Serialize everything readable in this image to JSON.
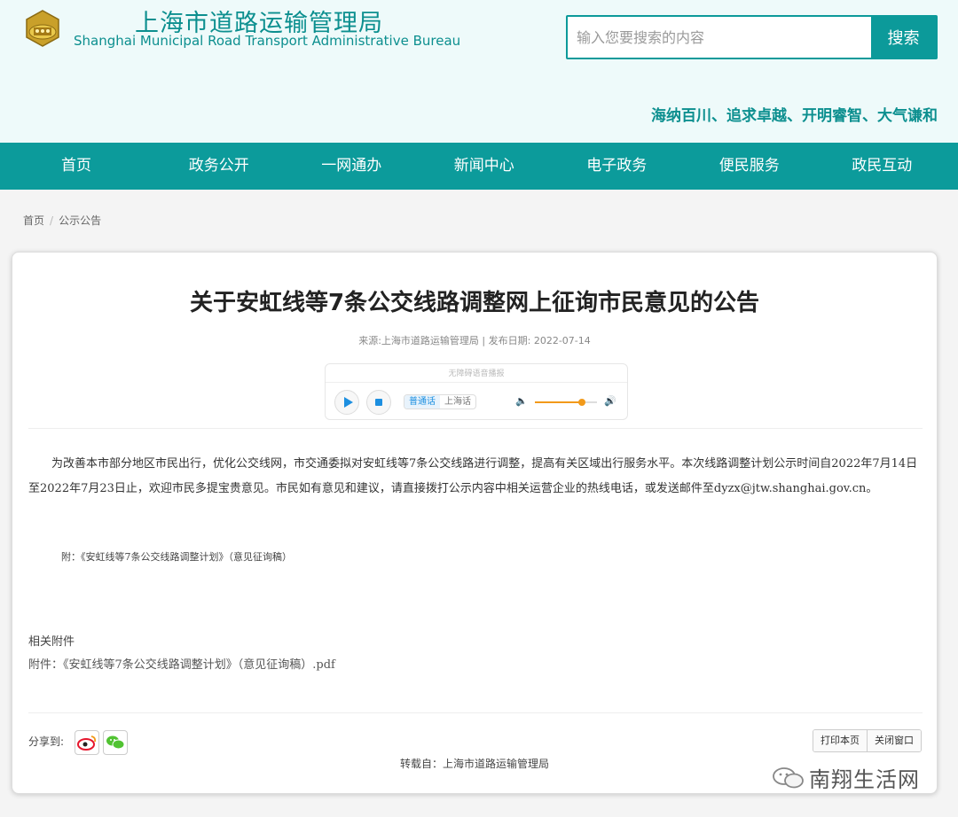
{
  "header": {
    "title_cn": "上海市道路运输管理局",
    "title_en": "Shanghai Municipal Road Transport Administrative Bureau",
    "search_placeholder": "输入您要搜索的内容",
    "search_button": "搜索",
    "slogan": "海纳百川、追求卓越、开明睿智、大气谦和",
    "brand_color": "#0c9b9b"
  },
  "nav": {
    "items": [
      "首页",
      "政务公开",
      "一网通办",
      "新闻中心",
      "电子政务",
      "便民服务",
      "政民互动"
    ]
  },
  "breadcrumb": {
    "home": "首页",
    "separator": "/",
    "current": "公示公告"
  },
  "article": {
    "title": "关于安虹线等7条公交线路调整网上征询市民意见的公告",
    "meta": "来源:上海市道路运输管理局 | 发布日期: 2022-07-14",
    "player": {
      "hint": "无障碍语音播报",
      "lang_mandarin": "普通话",
      "lang_shanghai": "上海话",
      "volume": 0.75
    },
    "body": "为改善本市部分地区市民出行，优化公交线网，市交通委拟对安虹线等7条公交线路进行调整，提高有关区域出行服务水平。本次线路调整计划公示时间自2022年7月14日至2022年7月23日止，欢迎市民多提宝贵意见。市民如有意见和建议，请直接拨打公示内容中相关运营企业的热线电话，或发送邮件至dyzx@jtw.shanghai.gov.cn。",
    "attachment_note": "附：《安虹线等7条公交线路调整计划》（意见征询稿）",
    "related_title": "相关附件",
    "related_link": "附件：《安虹线等7条公交线路调整计划》（意见征询稿）.pdf"
  },
  "footer": {
    "share_label": "分享到:",
    "print_button": "打印本页",
    "close_button": "关闭窗口",
    "repost": "转载自：上海市道路运输管理局"
  },
  "watermark": {
    "text": "南翔生活网"
  }
}
